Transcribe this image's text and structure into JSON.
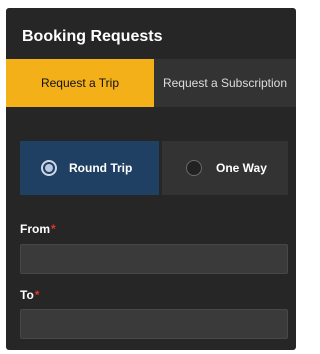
{
  "header": {
    "title": "Booking Requests"
  },
  "tabs": [
    {
      "label": "Request a Trip"
    },
    {
      "label": "Request a Subscription"
    }
  ],
  "trip_type": {
    "options": [
      {
        "label": "Round Trip"
      },
      {
        "label": "One Way"
      }
    ],
    "selected": "Round Trip"
  },
  "form": {
    "from": {
      "label": "From",
      "required_marker": "*",
      "value": ""
    },
    "to": {
      "label": "To",
      "required_marker": "*",
      "value": ""
    }
  },
  "colors": {
    "background": "#262626",
    "accent": "#f3b019",
    "selected_option": "#1f3f63",
    "required": "#e3342f"
  }
}
